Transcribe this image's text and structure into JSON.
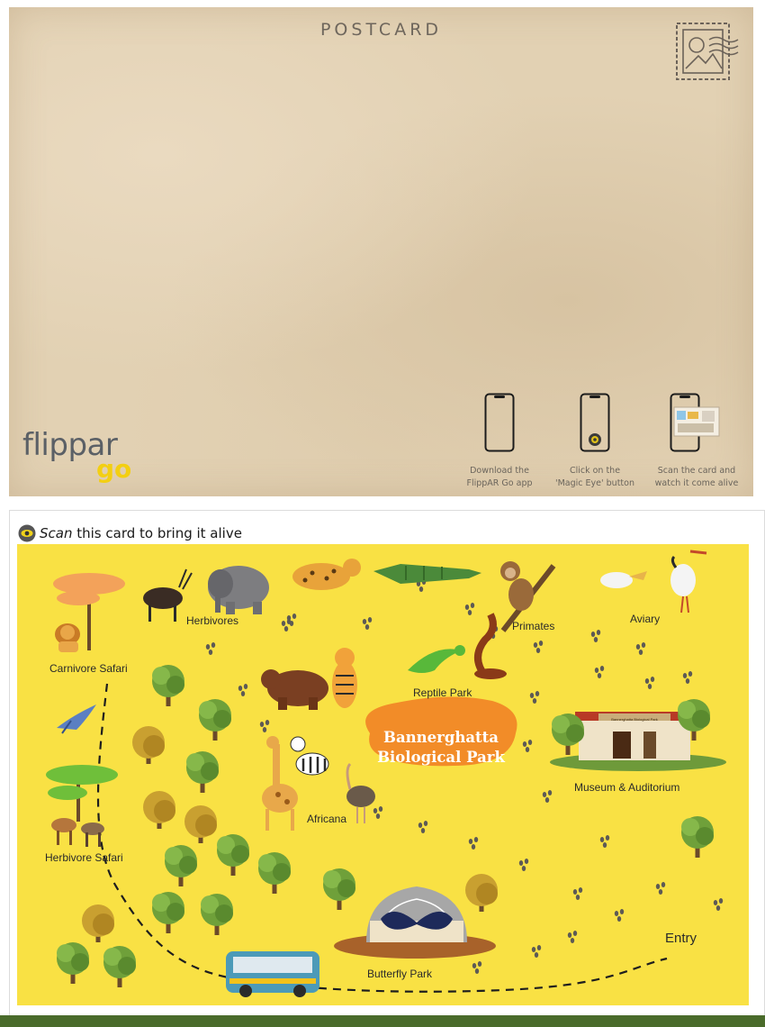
{
  "postcard": {
    "title": "POSTCARD",
    "logo": {
      "word": "flippar",
      "suffix": "go"
    },
    "steps": [
      {
        "line1": "Download the",
        "line2": "FlippAR Go app"
      },
      {
        "line1": "Click on the",
        "line2": "'Magic Eye' button"
      },
      {
        "line1": "Scan the card and",
        "line2": "watch it come alive"
      }
    ]
  },
  "map": {
    "scan_emphasis": "Scan",
    "scan_rest": " this card to bring it alive",
    "park_name_line1": "Bannerghatta",
    "park_name_line2": "Biological Park",
    "museum_sign": "Bannerghatta Biological Park",
    "zones": {
      "carnivore": "Carnivore Safari",
      "herbivores": "Herbivores",
      "primates": "Primates",
      "aviary": "Aviary",
      "reptile": "Reptile Park",
      "museum": "Museum & Auditorium",
      "africana": "Africana",
      "herbivore_safari": "Herbivore Safari",
      "butterfly": "Butterfly Park",
      "entry": "Entry"
    }
  },
  "colors": {
    "map_bg": "#f9e144",
    "sign_orange": "#f28c28",
    "paper": "#e2d1b3",
    "logo_yellow": "#f3cf12"
  }
}
